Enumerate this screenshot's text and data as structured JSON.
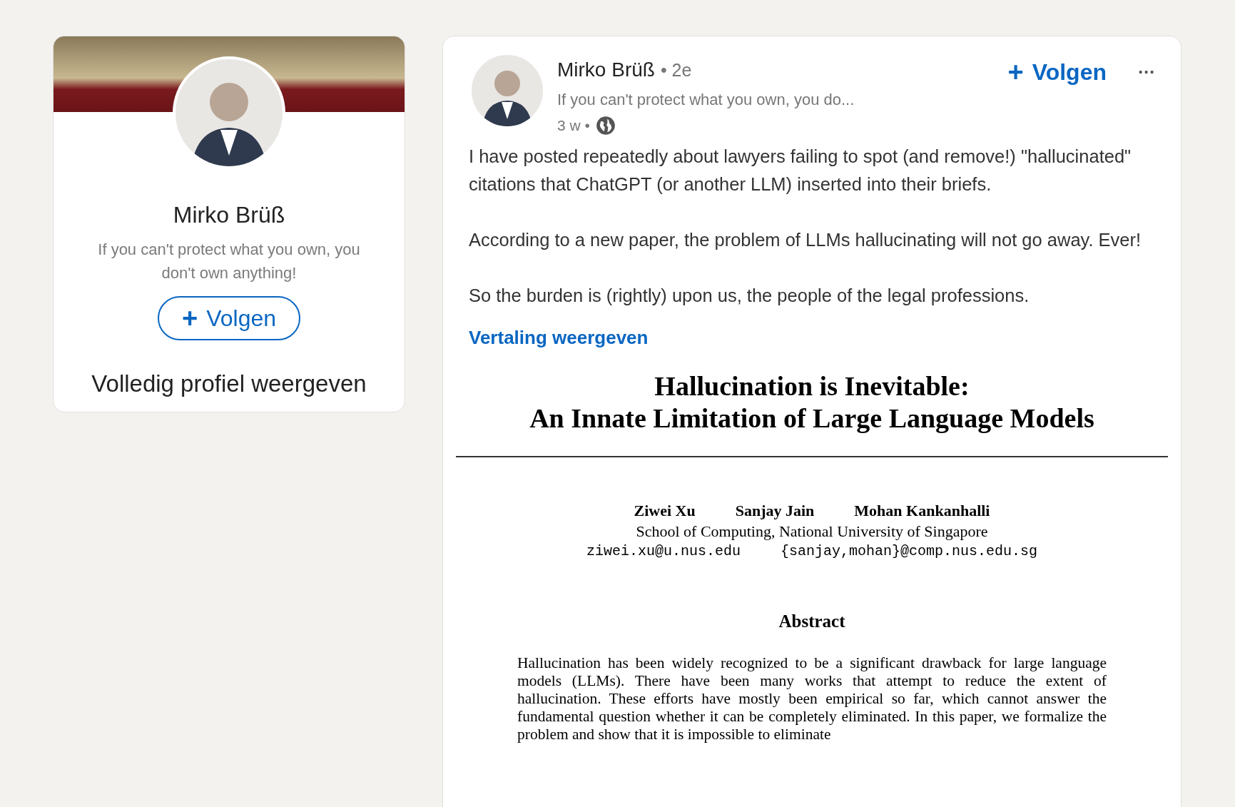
{
  "profile_card": {
    "name": "Mirko Brüß",
    "headline": "If you can't protect what you own, you don't own anything!",
    "follow_button": {
      "icon": "+",
      "label": "Volgen"
    },
    "view_profile_link": "Volledig profiel weergeven"
  },
  "post": {
    "author": "Mirko Brüß",
    "degree": "• 2e",
    "headline": "If you can't protect what you own, you do...",
    "age": "3 w •",
    "follow_button": {
      "icon": "+",
      "label": "Volgen"
    },
    "more_button": "···",
    "paragraphs": [
      "I have posted repeatedly about lawyers failing to spot (and remove!) \"hallucinated\" citations that ChatGPT (or another LLM) inserted into their briefs.",
      "According to a new paper, the problem of LLMs hallucinating will not go away. Ever!",
      "So the burden is (rightly) upon us, the people of the legal professions."
    ],
    "translate_link": "Vertaling weergeven",
    "paper": {
      "title_lines": [
        "Hallucination is Inevitable:",
        "An Innate Limitation of Large Language Models"
      ],
      "authors": [
        "Ziwei Xu",
        "Sanjay Jain",
        "Mohan Kankanhalli"
      ],
      "affiliation": "School of Computing, National University of Singapore",
      "emails": [
        "ziwei.xu@u.nus.edu",
        "{sanjay,mohan}@comp.nus.edu.sg"
      ],
      "abstract_heading": "Abstract",
      "abstract_text": "Hallucination has been widely recognized to be a significant drawback for large language models (LLMs). There have been many works that attempt to reduce the extent of hallucination. These efforts have mostly been empirical so far, which cannot answer the fundamental question whether it can be completely eliminated. In this paper, we formalize the problem and show that it is impossible to eliminate"
    }
  }
}
